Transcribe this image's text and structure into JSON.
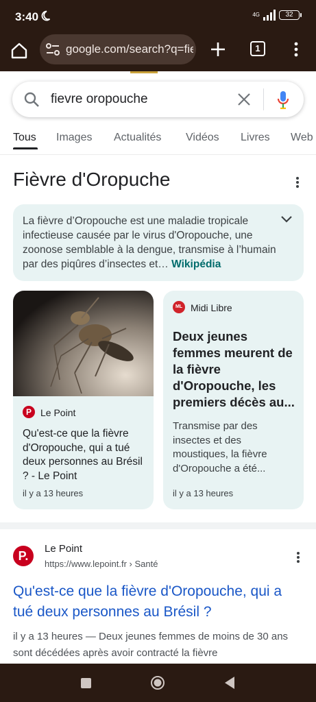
{
  "status_bar": {
    "time": "3:40",
    "network": "4G",
    "battery": "32"
  },
  "browser": {
    "url": "google.com/search?q=fie",
    "tab_count": "1"
  },
  "search": {
    "query": "fievre oropouche"
  },
  "tabs": [
    "Tous",
    "Images",
    "Actualités",
    "Vidéos",
    "Livres",
    "Web"
  ],
  "knowledge_panel": {
    "title": "Fièvre d'Oropuche",
    "description": "La fièvre d’Oropouche est une maladie tropicale infectieuse causée par le virus d'Oropouche, une zoonose semblable à la dengue, transmise à l’humain par des piqûres d’insectes et…",
    "source_link": "Wikipédia"
  },
  "news": [
    {
      "source": "Le Point",
      "logo_text": "P",
      "headline": "Qu'est-ce que la fièvre d'Oropouche, qui a tué deux personnes au Brésil ? - Le Point",
      "time": "il y a 13 heures"
    },
    {
      "source": "Midi Libre",
      "logo_text": "ML",
      "headline": "Deux jeunes femmes meurent de la fièvre d'Oropouche, les premiers décès au...",
      "snippet": "Transmise par des insectes et des moustiques, la fièvre d'Oropouche a été...",
      "time": "il y a 13 heures"
    }
  ],
  "result": {
    "site": "Le Point",
    "logo_text": "P.",
    "url": "https://www.lepoint.fr › Santé",
    "title": "Qu'est-ce que la fièvre d'Oropouche, qui a tué deux personnes au Brésil ?",
    "snippet": "il y a 13 heures — Deux jeunes femmes de moins de 30 ans sont décédées après avoir contracté la fièvre"
  },
  "colors": {
    "chrome": "#2a1a12",
    "card_bg": "#e8f3f3",
    "link": "#1a57c7",
    "accent_teal": "#006c6c"
  }
}
